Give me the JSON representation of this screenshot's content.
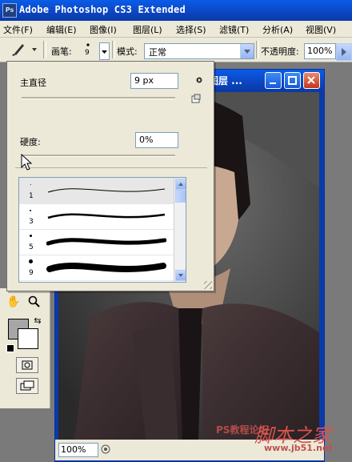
{
  "app": {
    "title": "Adobe Photoshop CS3 Extended",
    "logo": "Ps"
  },
  "menu": [
    "文件(F)",
    "编辑(E)",
    "图像(I)",
    "图层(L)",
    "选择(S)",
    "滤镜(T)",
    "分析(A)",
    "视图(V)"
  ],
  "options": {
    "brush_label": "画笔:",
    "brush_size": "9",
    "mode_label": "模式:",
    "mode_value": "正常",
    "opacity_label": "不透明度:",
    "opacity_value": "100%"
  },
  "brush_popup": {
    "diameter_label": "主直径",
    "diameter_value": "9 px",
    "diameter_level": 0.05,
    "hardness_label": "硬度:",
    "hardness_value": "0%",
    "hardness_level": 0.0,
    "brushes": [
      {
        "size": "1",
        "selected": true
      },
      {
        "size": "3",
        "selected": false
      },
      {
        "size": "5",
        "selected": false
      },
      {
        "size": "9",
        "selected": false
      }
    ]
  },
  "document": {
    "window_title": "图层 ...",
    "zoom": "100%"
  },
  "watermarks": [
    "PS教程论坛",
    "脚本之家",
    "www.jb51.net"
  ],
  "colors": {
    "titlebar": "#0c47c4",
    "foreground": "#a6a6a6",
    "background": "#ffffff"
  }
}
